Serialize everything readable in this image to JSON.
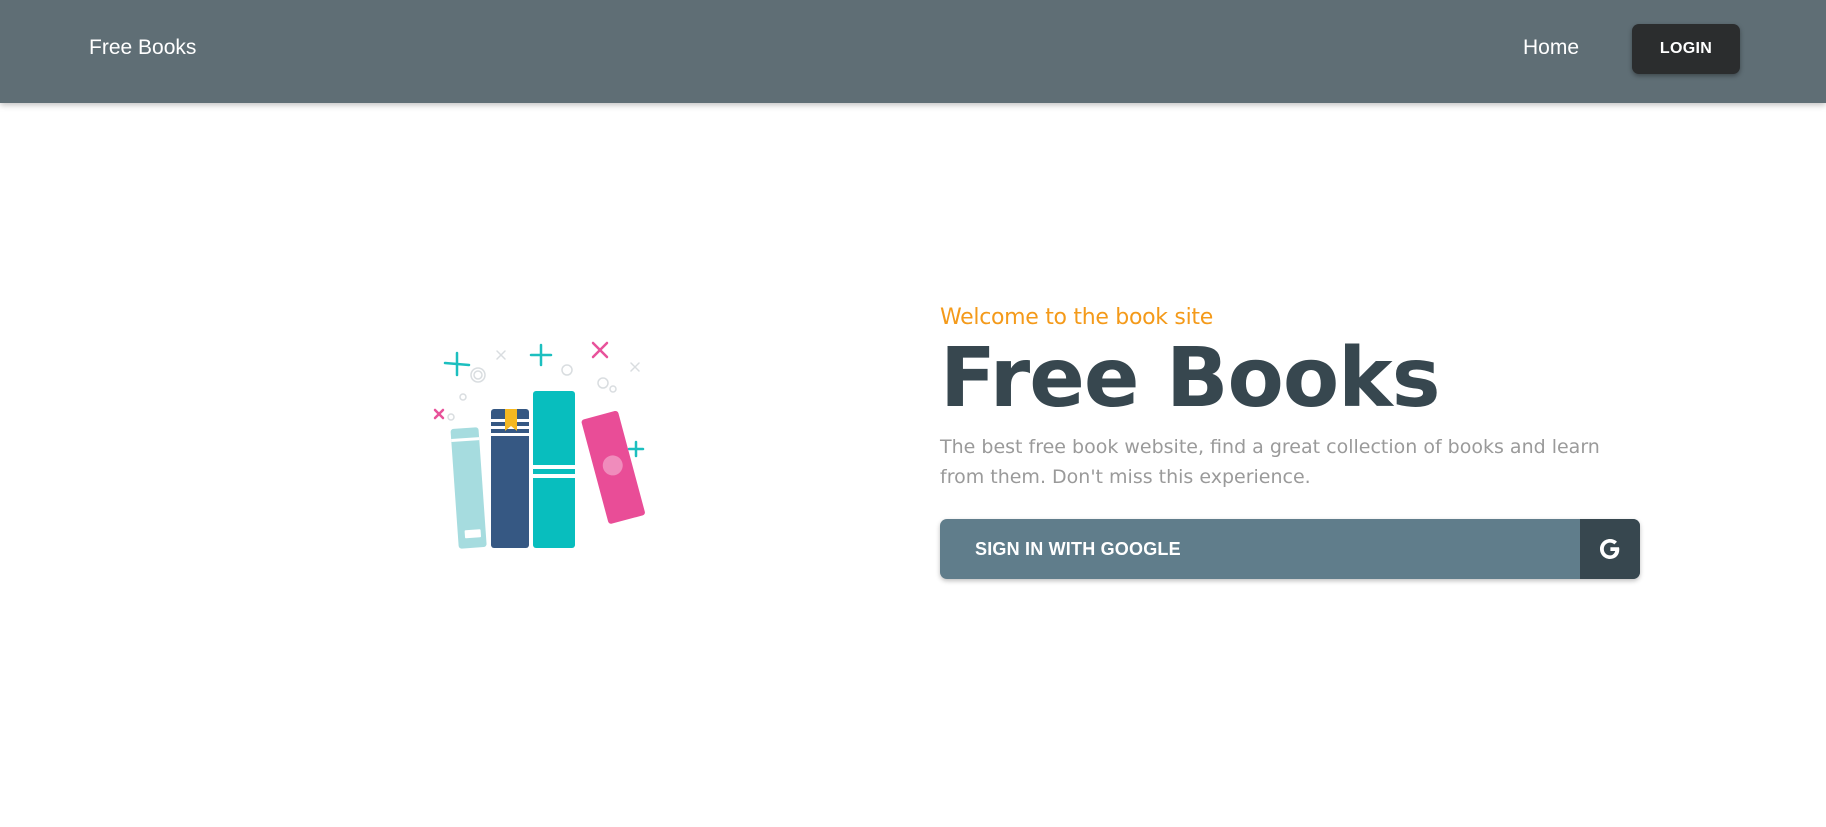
{
  "navbar": {
    "brand": "Free Books",
    "home_label": "Home",
    "login_label": "LOGIN"
  },
  "hero": {
    "eyebrow": "Welcome to the book site",
    "title": "Free Books",
    "description": "The best free book website, find a great collection of books and learn from them. Don't miss this experience.",
    "cta_label": "SIGN IN WITH GOOGLE",
    "cta_icon": "google-icon"
  },
  "colors": {
    "navbar_bg": "#5f6e75",
    "login_bg": "#2b2d2e",
    "eyebrow": "#f49a1a",
    "title": "#37474f",
    "description": "#9a9a9a",
    "cta_bg": "#607d8b",
    "cta_icon_bg": "#37474f"
  }
}
